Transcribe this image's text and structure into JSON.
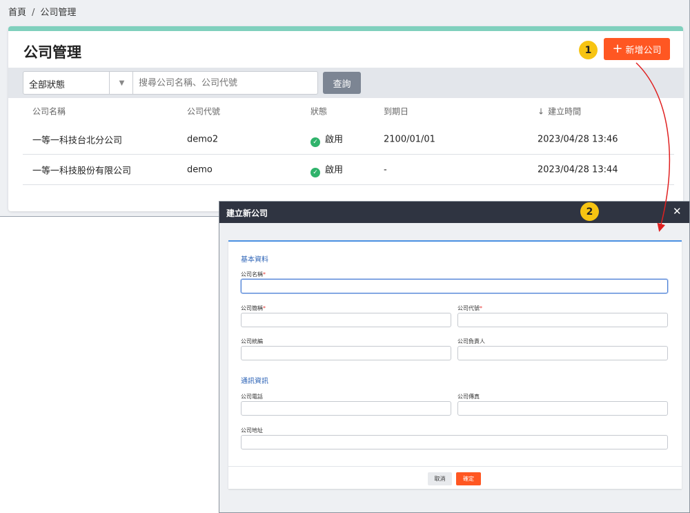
{
  "breadcrumb": {
    "home": "首頁",
    "separator": "/",
    "current": "公司管理"
  },
  "page": {
    "title": "公司管理",
    "add_button_label": "新增公司",
    "callout_1": "1",
    "callout_2": "2"
  },
  "filter": {
    "status_value": "全部狀態",
    "search_placeholder": "搜尋公司名稱、公司代號",
    "query_button_label": "查詢"
  },
  "table": {
    "headers": [
      "公司名稱",
      "公司代號",
      "狀態",
      "到期日",
      "建立時間"
    ],
    "sort_column": "建立時間",
    "rows": [
      {
        "name": "一等一科技台北分公司",
        "code": "demo2",
        "status": "啟用",
        "expiry": "2100/01/01",
        "created": "2023/04/28 13:46"
      },
      {
        "name": "一等一科技股份有限公司",
        "code": "demo",
        "status": "啟用",
        "expiry": "-",
        "created": "2023/04/28 13:44"
      }
    ]
  },
  "modal": {
    "title": "建立新公司",
    "close_glyph": "✕",
    "section_basic": "基本資料",
    "section_contact": "通訊資訊",
    "fields": {
      "company_name": "公司名稱",
      "company_short": "公司簡稱",
      "company_code": "公司代號",
      "tax_id": "公司統編",
      "owner": "公司負責人",
      "phone": "公司電話",
      "fax": "公司傳真",
      "address": "公司地址"
    },
    "required_mark": "*",
    "cancel_label": "取消",
    "confirm_label": "確定"
  },
  "colors": {
    "accent_orange": "#ff5722",
    "teal_bar": "#7fd0bd",
    "callout_yellow": "#f7c412",
    "modal_header": "#2f3441",
    "status_ok": "#2fb36b",
    "section_blue": "#2c63b6",
    "arrow_red": "#e02020"
  },
  "icons": {
    "plus": "plus-icon",
    "caret": "caret-down-icon",
    "status": "check-circle-icon",
    "sort": "arrow-down-icon",
    "close": "close-icon"
  }
}
